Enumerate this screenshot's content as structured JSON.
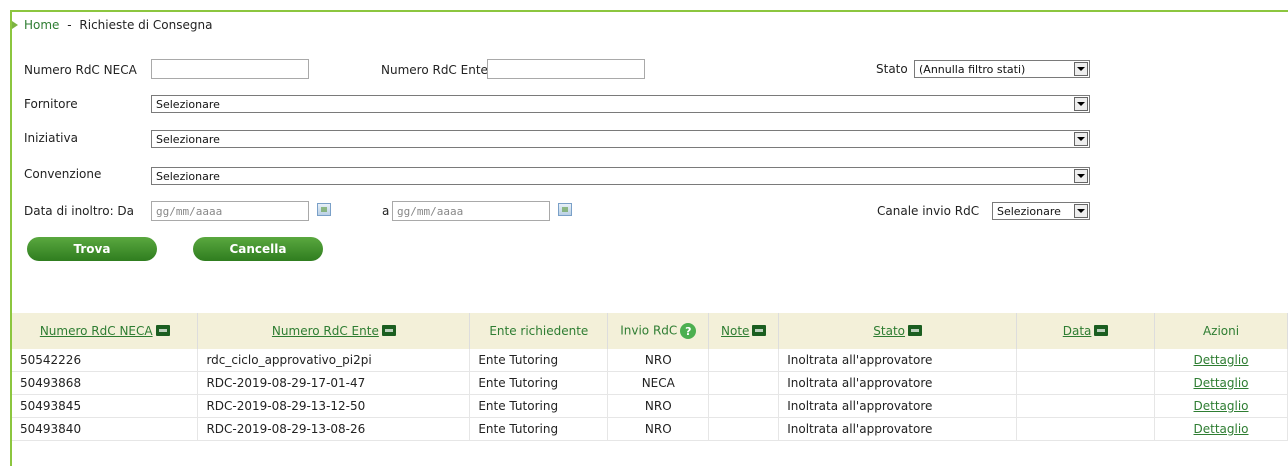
{
  "breadcrumb": {
    "home": "Home",
    "separator": " - ",
    "current": "Richieste di Consegna"
  },
  "filters": {
    "numero_neca_label": "Numero RdC NECA",
    "numero_ente_label": "Numero RdC Ente",
    "stato_label": "Stato",
    "stato_value": "(Annulla filtro stati)",
    "fornitore_label": "Fornitore",
    "fornitore_value": "Selezionare",
    "iniziativa_label": "Iniziativa",
    "iniziativa_value": "Selezionare",
    "convenzione_label": "Convenzione",
    "convenzione_value": "Selezionare",
    "data_da_label": "Data di inoltro: Da",
    "data_da_placeholder": "gg/mm/aaaa",
    "data_a_label": "a",
    "data_a_placeholder": "gg/mm/aaaa",
    "canale_label": "Canale invio RdC",
    "canale_value": "Selezionare"
  },
  "buttons": {
    "trova": "Trova",
    "cancella": "Cancella"
  },
  "table": {
    "headers": {
      "numero_neca": "Numero RdC NECA",
      "numero_ente": "Numero RdC Ente",
      "ente": "Ente richiedente",
      "invio": "Invio RdC",
      "note": "Note",
      "stato": "Stato",
      "data": "Data",
      "azioni": "Azioni"
    },
    "help_glyph": "?",
    "rows": [
      {
        "neca": "50542226",
        "ente_num": "rdc_ciclo_approvativo_pi2pi",
        "ente": "Ente Tutoring",
        "invio": "NRO",
        "note": "",
        "stato": "Inoltrata all'approvatore",
        "data": "",
        "azione": "Dettaglio"
      },
      {
        "neca": "50493868",
        "ente_num": "RDC-2019-08-29-17-01-47",
        "ente": "Ente Tutoring",
        "invio": "NECA",
        "note": "",
        "stato": "Inoltrata all'approvatore",
        "data": "",
        "azione": "Dettaglio"
      },
      {
        "neca": "50493845",
        "ente_num": "RDC-2019-08-29-13-12-50",
        "ente": "Ente Tutoring",
        "invio": "NRO",
        "note": "",
        "stato": "Inoltrata all'approvatore",
        "data": "",
        "azione": "Dettaglio"
      },
      {
        "neca": "50493840",
        "ente_num": "RDC-2019-08-29-13-08-26",
        "ente": "Ente Tutoring",
        "invio": "NRO",
        "note": "",
        "stato": "Inoltrata all'approvatore",
        "data": "",
        "azione": "Dettaglio"
      }
    ]
  },
  "colors": {
    "accent": "#8cc63f",
    "button": "#3d8c2a",
    "header_bg": "#f3f0d9",
    "link": "#2e7d32"
  }
}
